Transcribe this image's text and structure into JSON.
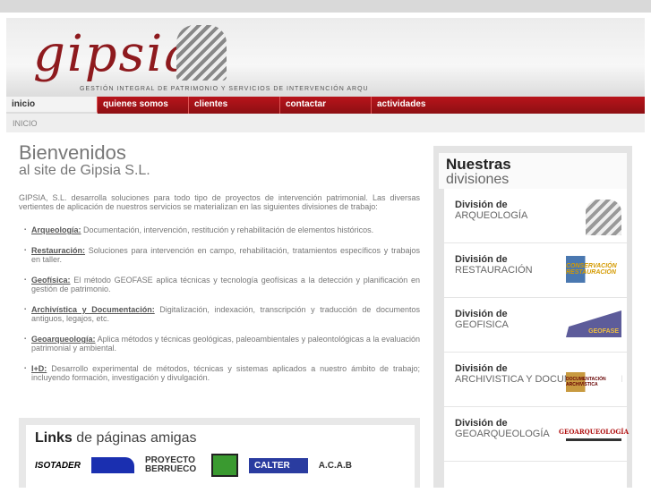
{
  "header": {
    "logo": "gipsia",
    "tagline": "GESTIÓN INTEGRAL DE PATRIMONIO Y SERVICIOS DE INTERVENCIÓN ARQU"
  },
  "nav": [
    "inicio",
    "quienes somos",
    "clientes",
    "contactar",
    "actividades"
  ],
  "breadcrumb": "INICIO",
  "main": {
    "title": "Bienvenidos",
    "subtitle": "al site de Gipsia S.L.",
    "intro": "GIPSIA, S.L. desarrolla soluciones para todo tipo de proyectos de intervención patrimonial. Las diversas vertientes de aplicación de nuestros servicios se materializan en las siguientes divisiones de trabajo:",
    "items": [
      {
        "label": "Arqueología:",
        "text": " Documentación, intervención, restitución y rehabilitación de elementos históricos."
      },
      {
        "label": "Restauración:",
        "text": " Soluciones para intervención en campo, rehabilitación, tratamientos específicos y trabajos en taller."
      },
      {
        "label": "Geofísica:",
        "text": " El método GEOFASE aplica técnicas y tecnología geofísicas a la detección y planificación en gestión de patrimonio."
      },
      {
        "label": "Archivística y Documentación:",
        "text": " Digitalización, indexación, transcripción y traducción de documentos antiguos, legajos, etc."
      },
      {
        "label": "Geoarqueología:",
        "text": " Aplica métodos y técnicas geológicas, paleoambientales y paleontológicas a la evaluación patrimonial y ambiental."
      },
      {
        "label": "I+D:",
        "text": " Desarrollo experimental de métodos, técnicas y sistemas aplicados a nuestro ámbito de trabajo; incluyendo formación, investigación y divulgación."
      }
    ]
  },
  "side": {
    "title_bold": "Nuestras",
    "title_rest": "divisiones",
    "divisions": [
      {
        "prefix": "División de",
        "name": "ARQUEOLOGÍA",
        "logo": ""
      },
      {
        "prefix": "División de",
        "name": "RESTAURACIÓN",
        "logo": "CONSERVACIÓN RESTAURACIÓN"
      },
      {
        "prefix": "División de",
        "name": "GEOFISICA",
        "logo": "GEOFASE"
      },
      {
        "prefix": "División de",
        "name": "ARCHIVISTICA Y DOCUMENTACION",
        "logo": "DOCUMENTACIÓN ARCHIVÍSTICA"
      },
      {
        "prefix": "División de",
        "name": "GEOARQUEOLOGÍA",
        "logo": "GEOARQUEOLOGÍA"
      }
    ]
  },
  "links": {
    "title_bold": "Links",
    "title_rest": " de páginas amigas",
    "logos": [
      "ISOTADER",
      "PROYECTO BERRUECO",
      "CALTER",
      "A.C.A.B"
    ]
  }
}
